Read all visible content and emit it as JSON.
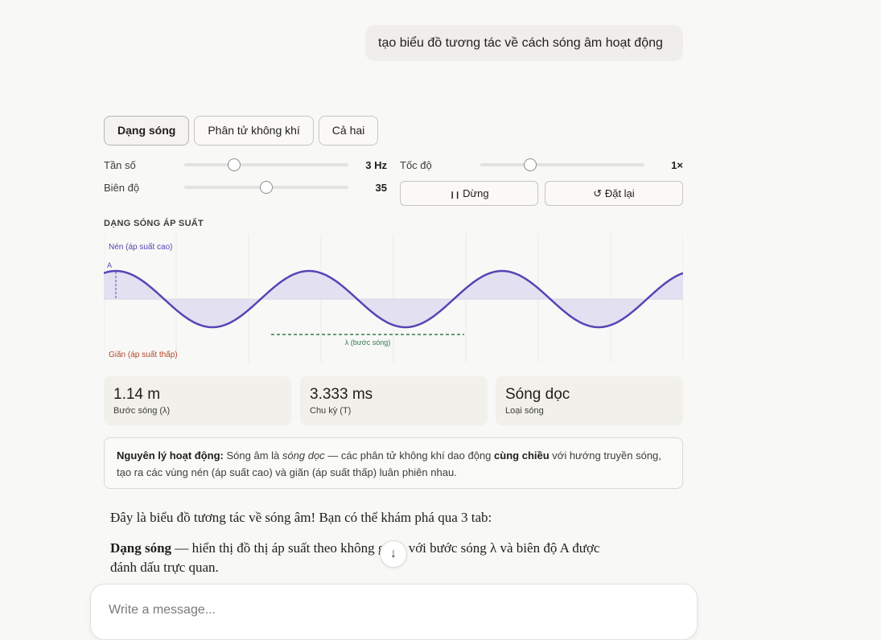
{
  "user_message": "tạo biểu đồ tương tác về cách sóng âm hoạt động",
  "tabs": [
    {
      "label": "Dạng sóng",
      "active": true
    },
    {
      "label": "Phân tử không khí",
      "active": false
    },
    {
      "label": "Cả hai",
      "active": false
    }
  ],
  "controls": {
    "frequency": {
      "label": "Tần số",
      "value": "3 Hz",
      "position": 0.3
    },
    "amplitude": {
      "label": "Biên độ",
      "value": "35",
      "position": 0.5
    },
    "speed": {
      "label": "Tốc độ",
      "value": "1×",
      "position": 0.3
    },
    "pause_label": "Dừng",
    "pause_icon": "pause-icon",
    "reset_label": "Đặt lại",
    "reset_icon": "refresh-icon"
  },
  "waveform": {
    "title": "DẠNG SÓNG ÁP SUẤT",
    "compression_label": "Nén (áp suất cao)",
    "rarefaction_label": "Giãn (áp suất thấp)",
    "amplitude_label": "A",
    "wavelength_label": "λ (bước sóng)",
    "colors": {
      "wave": "#5545b5",
      "fill": "#e3e1f1",
      "compression": "#5545b5",
      "rarefaction": "#b5452b",
      "wavelength": "#2f7a4d"
    }
  },
  "stats": [
    {
      "value": "1.14 m",
      "label": "Bước sóng (λ)"
    },
    {
      "value": "3.333 ms",
      "label": "Chu kỳ (T)"
    },
    {
      "value": "Sóng dọc",
      "label": "Loại sóng"
    }
  ],
  "info": {
    "heading": "Nguyên lý hoạt động:",
    "text1": "Sóng âm là",
    "italic": "sóng dọc",
    "text2": "— các phân tử không khí dao động",
    "bold": "cùng chiều",
    "text3": "với hướng truyền sóng, tạo ra các vùng nén (áp suất cao) và giãn (áp suất thấp) luân phiên nhau."
  },
  "answer": {
    "intro": "Đây là biểu đồ tương tác về sóng âm! Bạn có thể khám phá qua 3 tab:",
    "item_bold": "Dạng sóng",
    "item_line1": " — hiển thị đồ thị áp suất theo không gian, với bước sóng λ và biên độ A được",
    "item_line2": "đánh dấu trực quan."
  },
  "scroll_icon": "arrow-down-icon",
  "composer": {
    "placeholder": "Write a message..."
  }
}
